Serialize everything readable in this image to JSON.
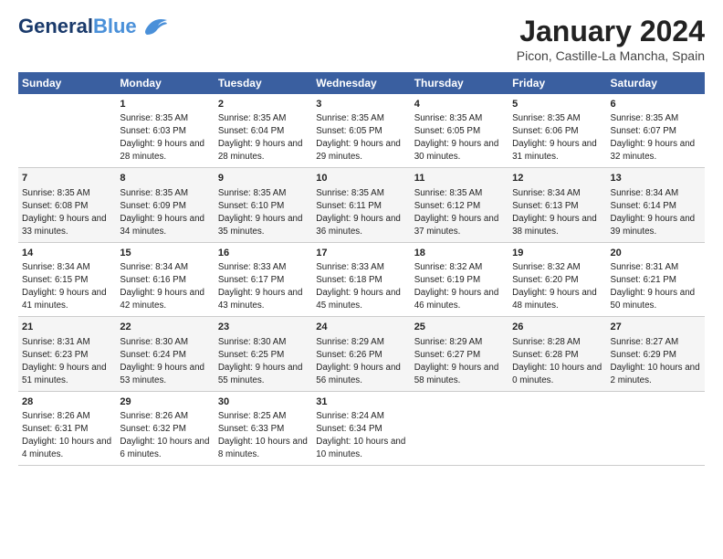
{
  "header": {
    "logo_line1": "General",
    "logo_line2": "Blue",
    "month": "January 2024",
    "location": "Picon, Castille-La Mancha, Spain"
  },
  "weekdays": [
    "Sunday",
    "Monday",
    "Tuesday",
    "Wednesday",
    "Thursday",
    "Friday",
    "Saturday"
  ],
  "rows": [
    [
      {
        "day": "",
        "sunrise": "",
        "sunset": "",
        "daylight": ""
      },
      {
        "day": "1",
        "sunrise": "Sunrise: 8:35 AM",
        "sunset": "Sunset: 6:03 PM",
        "daylight": "Daylight: 9 hours and 28 minutes."
      },
      {
        "day": "2",
        "sunrise": "Sunrise: 8:35 AM",
        "sunset": "Sunset: 6:04 PM",
        "daylight": "Daylight: 9 hours and 28 minutes."
      },
      {
        "day": "3",
        "sunrise": "Sunrise: 8:35 AM",
        "sunset": "Sunset: 6:05 PM",
        "daylight": "Daylight: 9 hours and 29 minutes."
      },
      {
        "day": "4",
        "sunrise": "Sunrise: 8:35 AM",
        "sunset": "Sunset: 6:05 PM",
        "daylight": "Daylight: 9 hours and 30 minutes."
      },
      {
        "day": "5",
        "sunrise": "Sunrise: 8:35 AM",
        "sunset": "Sunset: 6:06 PM",
        "daylight": "Daylight: 9 hours and 31 minutes."
      },
      {
        "day": "6",
        "sunrise": "Sunrise: 8:35 AM",
        "sunset": "Sunset: 6:07 PM",
        "daylight": "Daylight: 9 hours and 32 minutes."
      }
    ],
    [
      {
        "day": "7",
        "sunrise": "Sunrise: 8:35 AM",
        "sunset": "Sunset: 6:08 PM",
        "daylight": "Daylight: 9 hours and 33 minutes."
      },
      {
        "day": "8",
        "sunrise": "Sunrise: 8:35 AM",
        "sunset": "Sunset: 6:09 PM",
        "daylight": "Daylight: 9 hours and 34 minutes."
      },
      {
        "day": "9",
        "sunrise": "Sunrise: 8:35 AM",
        "sunset": "Sunset: 6:10 PM",
        "daylight": "Daylight: 9 hours and 35 minutes."
      },
      {
        "day": "10",
        "sunrise": "Sunrise: 8:35 AM",
        "sunset": "Sunset: 6:11 PM",
        "daylight": "Daylight: 9 hours and 36 minutes."
      },
      {
        "day": "11",
        "sunrise": "Sunrise: 8:35 AM",
        "sunset": "Sunset: 6:12 PM",
        "daylight": "Daylight: 9 hours and 37 minutes."
      },
      {
        "day": "12",
        "sunrise": "Sunrise: 8:34 AM",
        "sunset": "Sunset: 6:13 PM",
        "daylight": "Daylight: 9 hours and 38 minutes."
      },
      {
        "day": "13",
        "sunrise": "Sunrise: 8:34 AM",
        "sunset": "Sunset: 6:14 PM",
        "daylight": "Daylight: 9 hours and 39 minutes."
      }
    ],
    [
      {
        "day": "14",
        "sunrise": "Sunrise: 8:34 AM",
        "sunset": "Sunset: 6:15 PM",
        "daylight": "Daylight: 9 hours and 41 minutes."
      },
      {
        "day": "15",
        "sunrise": "Sunrise: 8:34 AM",
        "sunset": "Sunset: 6:16 PM",
        "daylight": "Daylight: 9 hours and 42 minutes."
      },
      {
        "day": "16",
        "sunrise": "Sunrise: 8:33 AM",
        "sunset": "Sunset: 6:17 PM",
        "daylight": "Daylight: 9 hours and 43 minutes."
      },
      {
        "day": "17",
        "sunrise": "Sunrise: 8:33 AM",
        "sunset": "Sunset: 6:18 PM",
        "daylight": "Daylight: 9 hours and 45 minutes."
      },
      {
        "day": "18",
        "sunrise": "Sunrise: 8:32 AM",
        "sunset": "Sunset: 6:19 PM",
        "daylight": "Daylight: 9 hours and 46 minutes."
      },
      {
        "day": "19",
        "sunrise": "Sunrise: 8:32 AM",
        "sunset": "Sunset: 6:20 PM",
        "daylight": "Daylight: 9 hours and 48 minutes."
      },
      {
        "day": "20",
        "sunrise": "Sunrise: 8:31 AM",
        "sunset": "Sunset: 6:21 PM",
        "daylight": "Daylight: 9 hours and 50 minutes."
      }
    ],
    [
      {
        "day": "21",
        "sunrise": "Sunrise: 8:31 AM",
        "sunset": "Sunset: 6:23 PM",
        "daylight": "Daylight: 9 hours and 51 minutes."
      },
      {
        "day": "22",
        "sunrise": "Sunrise: 8:30 AM",
        "sunset": "Sunset: 6:24 PM",
        "daylight": "Daylight: 9 hours and 53 minutes."
      },
      {
        "day": "23",
        "sunrise": "Sunrise: 8:30 AM",
        "sunset": "Sunset: 6:25 PM",
        "daylight": "Daylight: 9 hours and 55 minutes."
      },
      {
        "day": "24",
        "sunrise": "Sunrise: 8:29 AM",
        "sunset": "Sunset: 6:26 PM",
        "daylight": "Daylight: 9 hours and 56 minutes."
      },
      {
        "day": "25",
        "sunrise": "Sunrise: 8:29 AM",
        "sunset": "Sunset: 6:27 PM",
        "daylight": "Daylight: 9 hours and 58 minutes."
      },
      {
        "day": "26",
        "sunrise": "Sunrise: 8:28 AM",
        "sunset": "Sunset: 6:28 PM",
        "daylight": "Daylight: 10 hours and 0 minutes."
      },
      {
        "day": "27",
        "sunrise": "Sunrise: 8:27 AM",
        "sunset": "Sunset: 6:29 PM",
        "daylight": "Daylight: 10 hours and 2 minutes."
      }
    ],
    [
      {
        "day": "28",
        "sunrise": "Sunrise: 8:26 AM",
        "sunset": "Sunset: 6:31 PM",
        "daylight": "Daylight: 10 hours and 4 minutes."
      },
      {
        "day": "29",
        "sunrise": "Sunrise: 8:26 AM",
        "sunset": "Sunset: 6:32 PM",
        "daylight": "Daylight: 10 hours and 6 minutes."
      },
      {
        "day": "30",
        "sunrise": "Sunrise: 8:25 AM",
        "sunset": "Sunset: 6:33 PM",
        "daylight": "Daylight: 10 hours and 8 minutes."
      },
      {
        "day": "31",
        "sunrise": "Sunrise: 8:24 AM",
        "sunset": "Sunset: 6:34 PM",
        "daylight": "Daylight: 10 hours and 10 minutes."
      },
      {
        "day": "",
        "sunrise": "",
        "sunset": "",
        "daylight": ""
      },
      {
        "day": "",
        "sunrise": "",
        "sunset": "",
        "daylight": ""
      },
      {
        "day": "",
        "sunrise": "",
        "sunset": "",
        "daylight": ""
      }
    ]
  ]
}
